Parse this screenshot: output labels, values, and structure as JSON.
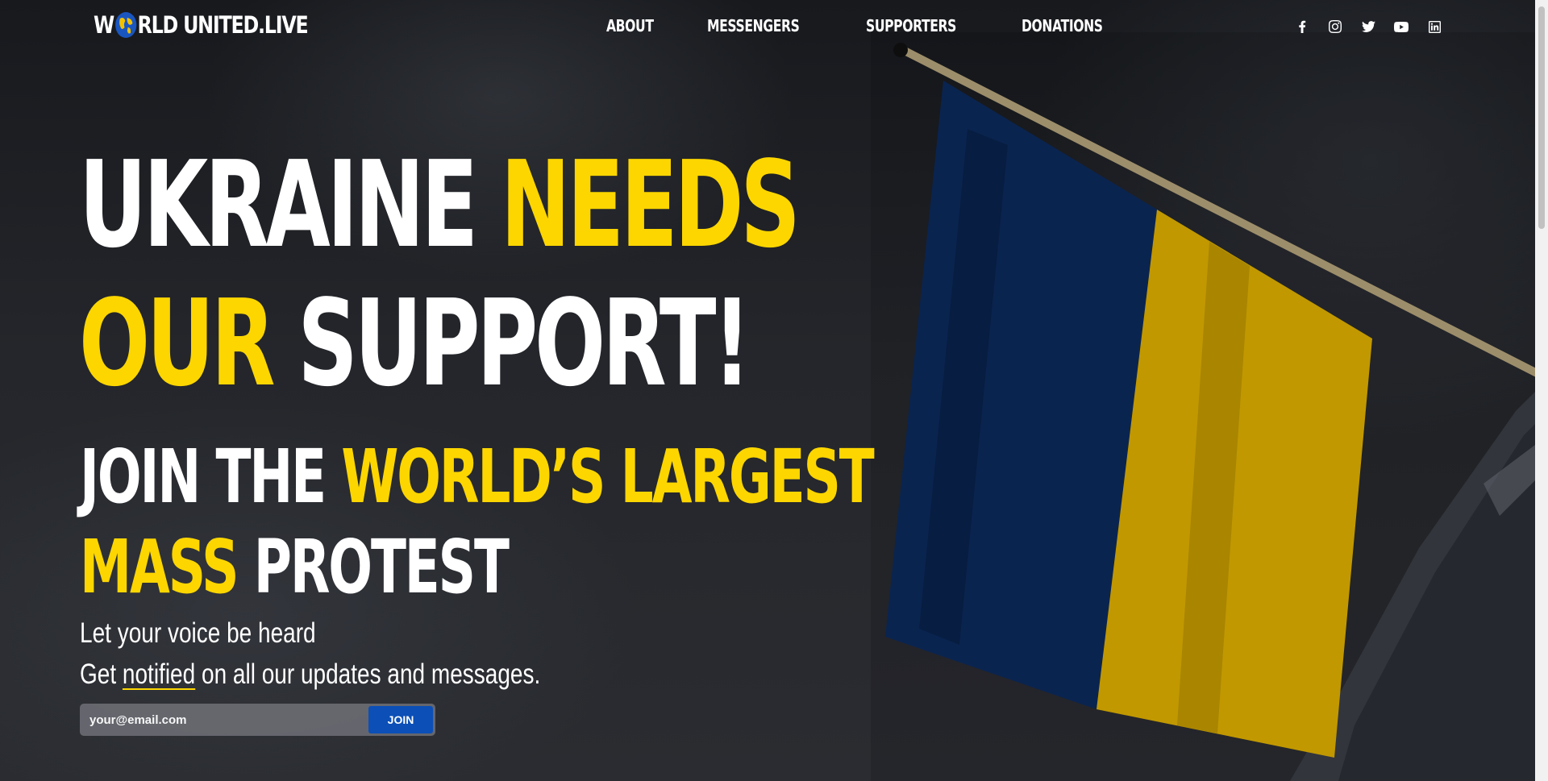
{
  "nav": {
    "logo_start": "W",
    "logo_end": "RLD UNITED.LIVE",
    "items": [
      {
        "label": "ABOUT"
      },
      {
        "label": "MESSENGERS"
      },
      {
        "label": "SUPPORTERS"
      },
      {
        "label": "DONATIONS"
      }
    ],
    "social_icons": [
      "facebook-icon",
      "instagram-icon",
      "twitter-icon",
      "youtube-icon",
      "linkedin-icon"
    ]
  },
  "hero": {
    "headline": {
      "line1_white": "UKRAINE ",
      "line1_yellow": "NEEDS",
      "line2_yellow": "OUR",
      "line2_white": " SUPPORT!"
    },
    "subhead": {
      "line1_white": "JOIN THE ",
      "line1_yellow": "WORLD’S LARGEST",
      "line2_yellow": "MASS",
      "line2_white": " PROTEST"
    },
    "tagline1": "Let your voice be heard",
    "tagline2_before": "Get ",
    "tagline2_link": "notified",
    "tagline2_after": " on all our updates and messages.",
    "email_placeholder": "your@email.com",
    "join_label": "JOIN"
  },
  "colors": {
    "accent_yellow": "#fdd600",
    "button_blue": "#0b4fb7",
    "flag_blue": "#0c2a5c",
    "flag_yellow": "#e0b000"
  }
}
